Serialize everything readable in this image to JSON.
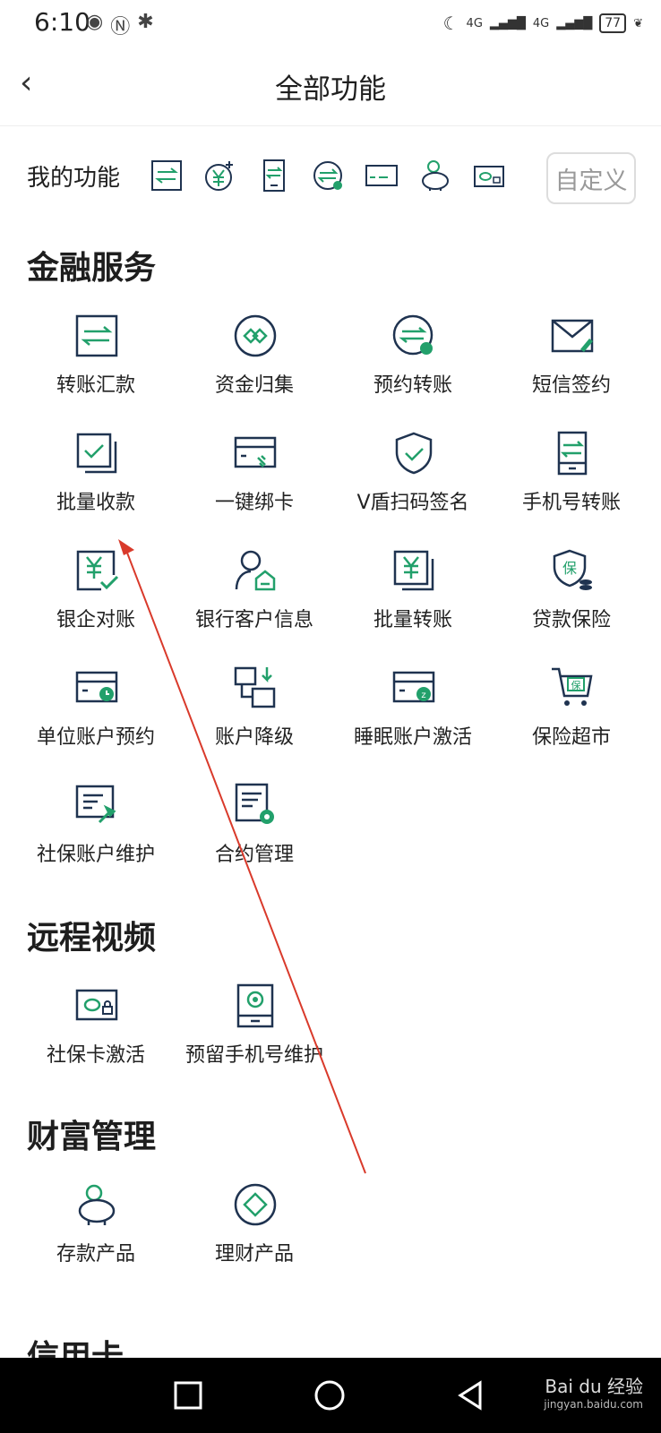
{
  "status": {
    "time": "6:10",
    "net1": "4G",
    "net2": "4G",
    "battery": "77"
  },
  "header": {
    "title": "全部功能"
  },
  "my_functions": {
    "label": "我的功能",
    "custom_button": "自定义"
  },
  "sections": {
    "finance": {
      "title": "金融服务",
      "items": [
        {
          "label": "转账汇款",
          "icon": "transfer-icon"
        },
        {
          "label": "资金归集",
          "icon": "fund-collect-icon"
        },
        {
          "label": "预约转账",
          "icon": "scheduled-transfer-icon"
        },
        {
          "label": "短信签约",
          "icon": "sms-sign-icon"
        },
        {
          "label": "批量收款",
          "icon": "batch-receive-icon"
        },
        {
          "label": "一键绑卡",
          "icon": "bind-card-icon"
        },
        {
          "label": "V盾扫码签名",
          "icon": "shield-scan-icon"
        },
        {
          "label": "手机号转账",
          "icon": "phone-transfer-icon"
        },
        {
          "label": "银企对账",
          "icon": "reconcile-icon"
        },
        {
          "label": "银行客户信息",
          "icon": "customer-info-icon"
        },
        {
          "label": "批量转账",
          "icon": "batch-transfer-icon"
        },
        {
          "label": "贷款保险",
          "icon": "loan-insurance-icon"
        },
        {
          "label": "单位账户预约",
          "icon": "account-reserve-icon"
        },
        {
          "label": "账户降级",
          "icon": "account-downgrade-icon"
        },
        {
          "label": "睡眠账户激活",
          "icon": "dormant-activate-icon"
        },
        {
          "label": "保险超市",
          "icon": "insurance-market-icon"
        },
        {
          "label": "社保账户维护",
          "icon": "social-maintain-icon"
        },
        {
          "label": "合约管理",
          "icon": "contract-manage-icon"
        }
      ]
    },
    "remote": {
      "title": "远程视频",
      "items": [
        {
          "label": "社保卡激活",
          "icon": "social-card-activate-icon"
        },
        {
          "label": "预留手机号维护",
          "icon": "reserved-phone-icon"
        }
      ]
    },
    "wealth": {
      "title": "财富管理",
      "items": [
        {
          "label": "存款产品",
          "icon": "piggy-bank-icon"
        },
        {
          "label": "理财产品",
          "icon": "diamond-icon"
        }
      ]
    },
    "credit": {
      "title": "信用卡"
    }
  },
  "watermark": {
    "brand": "Bai du 经验",
    "url": "jingyan.baidu.com"
  },
  "colors": {
    "navy": "#1f3350",
    "green": "#22a06b"
  }
}
